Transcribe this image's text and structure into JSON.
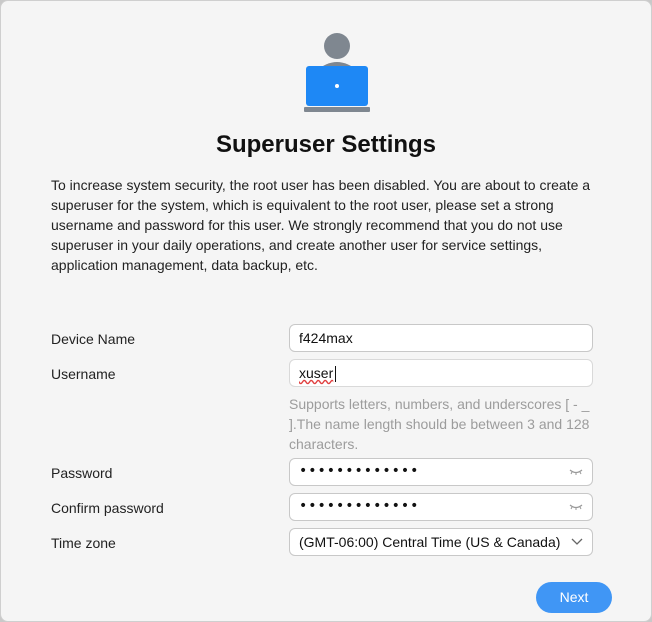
{
  "header": {
    "title": "Superuser Settings",
    "description": "To increase system security, the root user has been disabled. You are about to create a superuser for the system, which is equivalent to the root user, please set a strong username and password for this user. We strongly recommend that you do not use superuser in your daily operations, and create another user for service settings, application management, data backup, etc."
  },
  "form": {
    "device_name": {
      "label": "Device Name",
      "value": "f424max"
    },
    "username": {
      "label": "Username",
      "value": "xuser",
      "hint": "Supports letters, numbers, and underscores [ - _ ].The name length should be between 3 and 128 characters."
    },
    "password": {
      "label": "Password",
      "masked": "•••••••••••••"
    },
    "confirm_password": {
      "label": "Confirm password",
      "masked": "•••••••••••••"
    },
    "time_zone": {
      "label": "Time zone",
      "selected": "(GMT-06:00) Central Time (US & Canada)"
    }
  },
  "actions": {
    "next_label": "Next"
  },
  "colors": {
    "accent": "#4096f5",
    "icon_person": "#7f8790",
    "icon_laptop": "#1e88f5"
  },
  "icons": {
    "hero": "superuser-laptop-icon",
    "eye": "eye-closed-icon",
    "select": "chevron-down-icon"
  }
}
